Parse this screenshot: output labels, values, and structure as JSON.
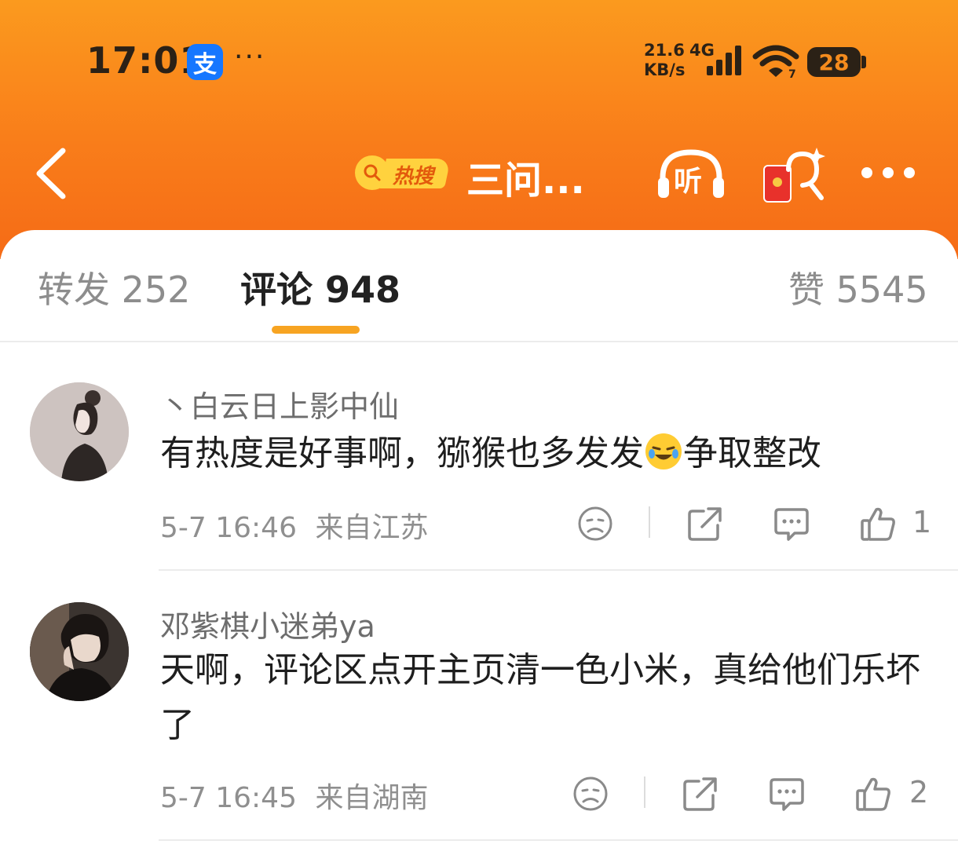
{
  "status_bar": {
    "time": "17:01",
    "app_badge": "支",
    "dots": "···",
    "net_speed_value": "21.6",
    "net_speed_unit": "KB/s",
    "network": "4G",
    "battery": "28",
    "wifi_badge": "7"
  },
  "nav": {
    "hot_label": "热搜",
    "title": "三问...",
    "listen_label": "听"
  },
  "tabs": {
    "repost": "转发 252",
    "comments": "评论 948",
    "likes": "赞 5545"
  },
  "comments": [
    {
      "username": "丶白云日上影中仙",
      "text_before": "有热度是好事啊，猕猴也多发发",
      "text_after": "争取整改",
      "time": "5-7 16:46",
      "location": "来自江苏",
      "likes": "1"
    },
    {
      "username": "邓紫棋小迷弟ya",
      "text": "天啊，评论区点开主页清一色小米，真给他们乐坏了",
      "time": "5-7 16:45",
      "location": "来自湖南",
      "likes": "2"
    }
  ],
  "colors": {
    "header_top": "#fb9a1e",
    "header_bottom": "#f56b16",
    "tab_underline": "#f7a422"
  }
}
